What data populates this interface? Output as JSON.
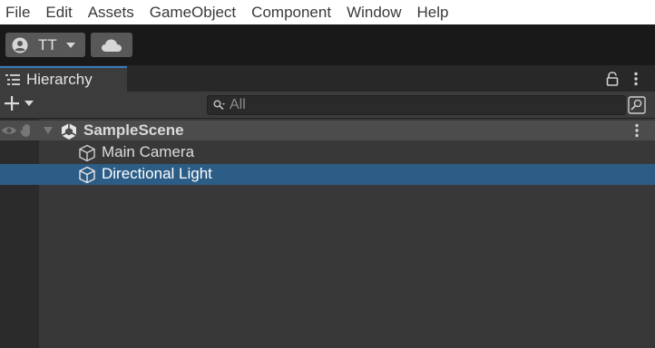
{
  "menu": [
    "File",
    "Edit",
    "Assets",
    "GameObject",
    "Component",
    "Window",
    "Help"
  ],
  "toolbar": {
    "account_label": "TT",
    "account_icon": "user-circle-icon",
    "cloud_icon": "cloud-icon"
  },
  "panel": {
    "tab_label": "Hierarchy",
    "tab_icon": "hierarchy-list-icon"
  },
  "hierarchy_toolbar": {
    "create_icon": "plus-icon",
    "search_placeholder": "All"
  },
  "scene": {
    "name": "SampleScene",
    "objects": [
      {
        "label": "Main Camera",
        "selected": false
      },
      {
        "label": "Directional Light",
        "selected": true
      }
    ]
  },
  "colors": {
    "accent": "#3a79bb",
    "selection": "#2c5d87",
    "panel_bg": "#383838"
  }
}
